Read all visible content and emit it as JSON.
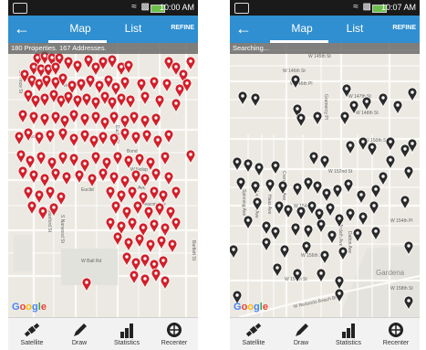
{
  "screens": [
    {
      "status": {
        "time": "10:00 AM"
      },
      "header": {
        "back_icon": "back-arrow-icon",
        "tabs": [
          "Map",
          "List"
        ],
        "active_tab": "Map",
        "refine_label": "REFINE"
      },
      "banner": "180 Properties. 167 Addresses.",
      "pin_color": "#d0202a",
      "map_labels": [
        "Tedro",
        "W Nolsp",
        "Alondra",
        "Ave",
        "Beacon Ave",
        "W Ball Rd",
        "S Narwood St",
        "Stanford St",
        "S Prince St",
        "Euclid",
        "Bond",
        "Euclid St",
        "Bartlett St",
        "S"
      ],
      "google": "Google",
      "toolbar": [
        {
          "label": "Satellite",
          "icon": "satellite-icon"
        },
        {
          "label": "Draw",
          "icon": "pencil-icon"
        },
        {
          "label": "Statistics",
          "icon": "bar-chart-icon"
        },
        {
          "label": "Recenter",
          "icon": "recenter-icon"
        }
      ]
    },
    {
      "status": {
        "time": "10:07 AM"
      },
      "header": {
        "back_icon": "back-arrow-icon",
        "tabs": [
          "Map",
          "List"
        ],
        "active_tab": "Map",
        "refine_label": "REFINE"
      },
      "banner": "Searching...",
      "pin_color": "#2a2a2a",
      "map_labels": [
        "W 145th St",
        "W 146th St",
        "W 146th Pl",
        "W 147th St",
        "W 148th St",
        "W 150th St",
        "W 152nd St",
        "W 154th St",
        "W 154th Pl",
        "W 156th St",
        "W 157th St",
        "W 158th St",
        "W Redondo Beach Blvd",
        "Gardena",
        "Gramercy Pl",
        "Spinning Ave",
        "La Verne Ave",
        "Haas Ave",
        "Crenshaw Ave",
        "Ardath Ave",
        "Dalton Ave"
      ],
      "google": "Google",
      "toolbar": [
        {
          "label": "Satellite",
          "icon": "satellite-icon"
        },
        {
          "label": "Draw",
          "icon": "pencil-icon"
        },
        {
          "label": "Statistics",
          "icon": "bar-chart-icon"
        },
        {
          "label": "Recenter",
          "icon": "recenter-icon"
        }
      ]
    }
  ]
}
